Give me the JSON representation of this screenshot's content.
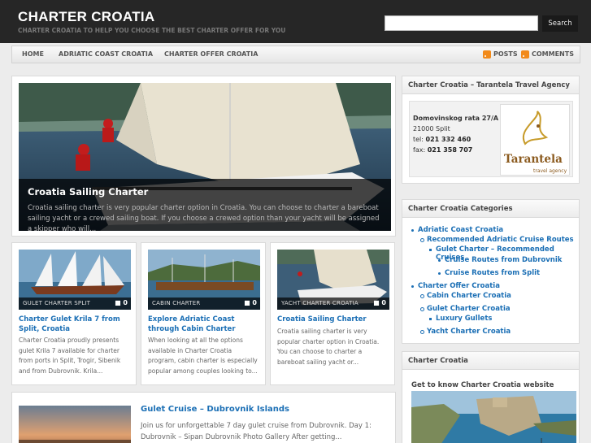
{
  "site": {
    "title": "CHARTER CROATIA",
    "tagline": "CHARTER CROATIA TO HELP YOU CHOOSE THE BEST CHARTER OFFER FOR YOU"
  },
  "search": {
    "placeholder": "",
    "button_label": "Search"
  },
  "nav": {
    "items": [
      "HOME",
      "ADRIATIC COAST CROATIA",
      "CHARTER OFFER CROATIA"
    ],
    "posts_label": "POSTS",
    "comments_label": "COMMENTS",
    "icons": [
      "rss-icon",
      "rss-icon"
    ]
  },
  "featured": {
    "title": "Croatia Sailing Charter",
    "excerpt": "Croatia sailing charter is very popular charter option in Croatia. You can choose to charter a bareboat sailing yacht or a crewed sailing boat. If you choose a crewed option than your yacht will be assigned a skipper who will..."
  },
  "cards": [
    {
      "label": "GULET CHARTER SPLIT",
      "count": "0",
      "title": "Charter Gulet Krila 7 from Split, Croatia",
      "excerpt": "Charter Croatia proudly presents gulet Krila 7 available for charter from ports in Split, Trogir, Sibenik and from Dubrovnik. Krila..."
    },
    {
      "label": "CABIN CHARTER",
      "count": "0",
      "title": "Explore Adriatic Coast through Cabin Charter",
      "excerpt": "When looking at all the options available in Charter Croatia program, cabin charter is especially popular among couples looking to..."
    },
    {
      "label": "YACHT CHARTER CROATIA",
      "count": "0",
      "title": "Croatia Sailing Charter",
      "excerpt": "Croatia sailing charter is very popular charter option in Croatia. You can choose to charter a bareboat sailing yacht or..."
    }
  ],
  "post": {
    "title": "Gulet Cruise – Dubrovnik Islands",
    "excerpt": "Join us for unforgettable 7 day gulet cruise from Dubrovnik. Day 1: Dubrovnik – Sipan Dubrovnik Photo Gallery After getting..."
  },
  "agency": {
    "title": "Charter Croatia – Tarantela Travel Agency",
    "street": "Domovinskog rata 27/A",
    "city": "21000 Split",
    "tel_label": "tel:",
    "tel": "021 332 460",
    "fax_label": "fax:",
    "fax": "021 358 707",
    "logo_text": "Tarantela",
    "logo_sub": "travel agency"
  },
  "categories": {
    "title": "Charter Croatia Categories",
    "items": [
      "Adriatic Coast Croatia",
      "Recommended Adriatic Cruise Routes",
      "Gulet Charter – Recommended Cruises",
      "Cruise Routes from Dubrovnik",
      "Cruise Routes from Split",
      "Charter Offer Croatia",
      "Cabin Charter Croatia",
      "Gulet Charter Croatia",
      "Luxury Gullets",
      "Yacht Charter Croatia"
    ]
  },
  "croatia_widget": {
    "title": "Charter Croatia",
    "subtitle": "Get to know Charter Croatia website"
  },
  "colors": {
    "link": "#1b6fb5",
    "header_bg": "#262626",
    "rss": "#f28a1a"
  }
}
